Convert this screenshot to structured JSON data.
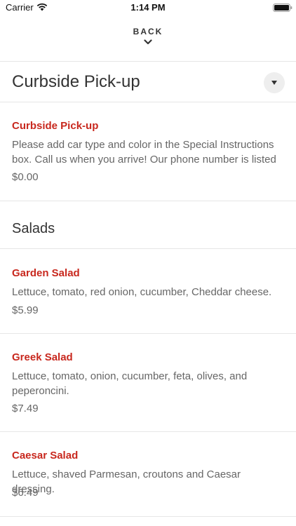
{
  "status_bar": {
    "carrier": "Carrier",
    "time": "1:14 PM",
    "wifi_icon": "wifi-icon",
    "battery_icon": "battery-icon"
  },
  "nav": {
    "back_label": "BACK",
    "back_icon": "chevron-down-icon"
  },
  "sections": [
    {
      "title": "Curbside Pick-up",
      "toggle_icon": "caret-down-icon",
      "items": [
        {
          "name": "Curbside Pick-up",
          "description": "Please add car type and color in the Special Instructions box. Call us when you arrive! Our phone number is listed",
          "price": "$0.00"
        }
      ]
    },
    {
      "title": "Salads",
      "items": [
        {
          "name": "Garden Salad",
          "description": "Lettuce, tomato, red onion, cucumber, Cheddar cheese.",
          "price": "$5.99"
        },
        {
          "name": "Greek Salad",
          "description": "Lettuce, tomato, onion, cucumber, feta, olives, and peperoncini.",
          "price": "$7.49"
        },
        {
          "name": "Caesar Salad",
          "description": "Lettuce, shaved Parmesan, croutons and Caesar dressing.",
          "price": "$6.49"
        }
      ]
    }
  ],
  "colors": {
    "accent": "#c8281e",
    "text": "#333333",
    "muted": "#666666",
    "divider": "#e6e6e6"
  }
}
